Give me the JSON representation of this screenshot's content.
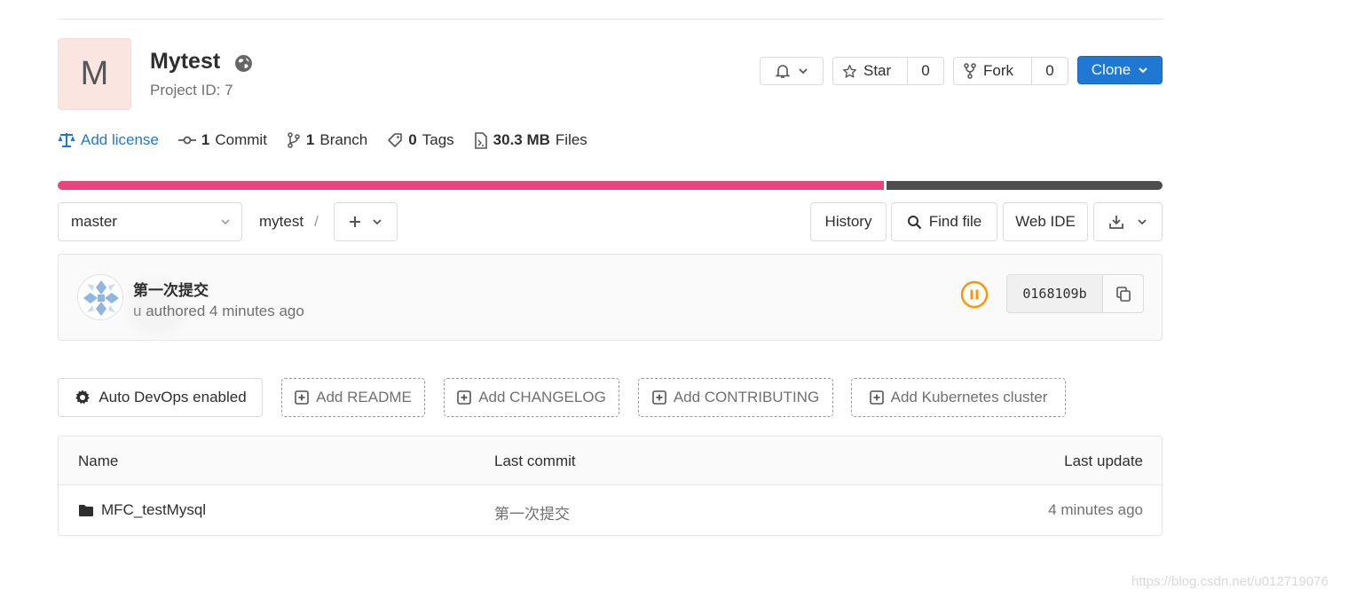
{
  "project": {
    "avatar_letter": "M",
    "name": "Mytest",
    "id_text": "Project ID: 7"
  },
  "header_buttons": {
    "star_label": "Star",
    "star_count": "0",
    "fork_label": "Fork",
    "fork_count": "0",
    "clone_label": "Clone"
  },
  "stats": {
    "license_label": "Add license",
    "commit_count": "1",
    "commit_label": "Commit",
    "branch_count": "1",
    "branch_label": "Branch",
    "tag_count": "0",
    "tag_label": "Tags",
    "files_size": "30.3 MB",
    "files_label": "Files"
  },
  "languages": [
    {
      "color": "#e8467a",
      "percent": 74.8
    },
    {
      "color": "#4d4d4d",
      "percent": 25.2
    }
  ],
  "nav": {
    "branch": "master",
    "breadcrumb_root": "mytest",
    "breadcrumb_sep": "/",
    "history_label": "History",
    "find_file_label": "Find file",
    "web_ide_label": "Web IDE"
  },
  "last_commit": {
    "title": "第一次提交",
    "author_fragment": "u",
    "authored_text": "authored 4 minutes ago",
    "sha": "0168109b",
    "pipeline_status": "paused",
    "status_color": "#fc9403"
  },
  "quick_actions": {
    "auto_devops": "Auto DevOps enabled",
    "readme": "Add README",
    "changelog": "Add CHANGELOG",
    "contributing": "Add CONTRIBUTING",
    "kubernetes": "Add Kubernetes cluster"
  },
  "file_table": {
    "headers": {
      "name": "Name",
      "last_commit": "Last commit",
      "last_update": "Last update"
    },
    "rows": [
      {
        "name": "MFC_testMysql",
        "type": "folder-icon",
        "last_commit": "第一次提交",
        "last_update": "4 minutes ago"
      }
    ]
  },
  "watermark": "https://blog.csdn.net/u012719076",
  "colors": {
    "accent": "#1f78d1",
    "text": "#2e2e2e",
    "muted": "#707070"
  }
}
